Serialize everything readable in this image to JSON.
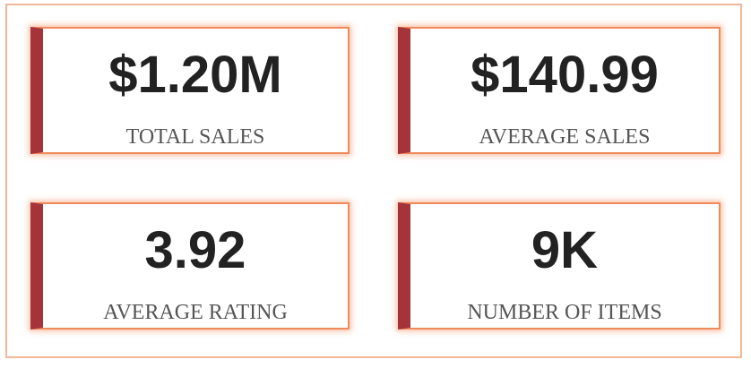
{
  "kpis": [
    {
      "value": "$1.20M",
      "label": "TOTAL SALES"
    },
    {
      "value": "$140.99",
      "label": "AVERAGE SALES"
    },
    {
      "value": "3.92",
      "label": "AVERAGE RATING"
    },
    {
      "value": "9K",
      "label": "NUMBER OF ITEMS"
    }
  ],
  "colors": {
    "accent_bar": "#a4343a",
    "card_border": "#f08a5d",
    "panel_border": "#f2b79a",
    "value_text": "#222222",
    "label_text": "#555555"
  }
}
